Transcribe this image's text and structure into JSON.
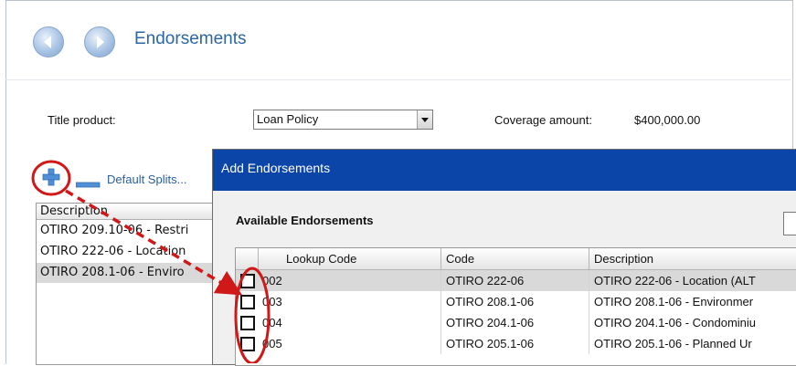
{
  "page": {
    "title": "Endorsements"
  },
  "nav": {
    "back_icon": "arrow-left-icon",
    "forward_icon": "arrow-right-icon"
  },
  "form": {
    "title_product_label": "Title product:",
    "title_product_value": "Loan Policy",
    "coverage_label": "Coverage amount:",
    "coverage_value": "$400,000.00"
  },
  "toolbar": {
    "add_icon": "plus-icon",
    "remove_icon": "minus-icon",
    "default_splits_label": "Default Splits..."
  },
  "left_list": {
    "header": "Description",
    "rows": [
      "OTIRO 209.10-06 - Restri",
      "OTIRO 222-06 - Location",
      "OTIRO 208.1-06 - Enviro"
    ]
  },
  "dialog": {
    "title": "Add Endorsements",
    "section_label": "Available Endorsements",
    "columns": [
      "Lookup Code",
      "Code",
      "Description"
    ],
    "rows": [
      {
        "lookup": "002",
        "code": "OTIRO 222-06",
        "description": "OTIRO 222-06 - Location (ALT"
      },
      {
        "lookup": "003",
        "code": "OTIRO 208.1-06",
        "description": "OTIRO 208.1-06 - Environmer"
      },
      {
        "lookup": "004",
        "code": "OTIRO 204.1-06",
        "description": "OTIRO 204.1-06 - Condominiu"
      },
      {
        "lookup": "005",
        "code": "OTIRO 205.1-06",
        "description": "OTIRO 205.1-06 - Planned Ur"
      }
    ]
  },
  "colors": {
    "title_blue": "#2a66a8",
    "dialog_title_bg": "#0c45a8",
    "annotation_red": "#d01818",
    "selected_row": "#d9d9d9"
  }
}
